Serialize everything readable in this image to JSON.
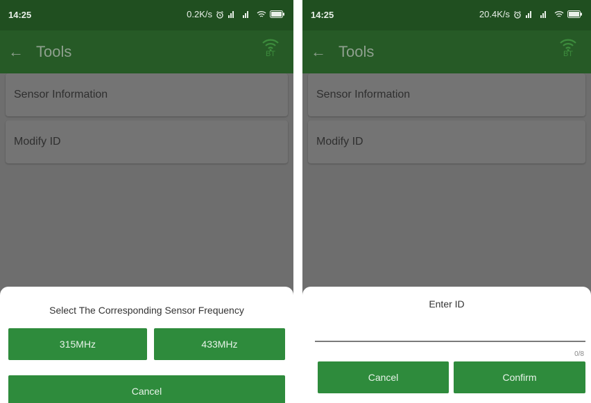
{
  "left": {
    "status": {
      "time": "14:25",
      "speed": "0.2K/s"
    },
    "appbar": {
      "back": "←",
      "title": "Tools",
      "bt_label": "BT"
    },
    "list": [
      {
        "label": "Sensor Information"
      },
      {
        "label": "Modify ID"
      }
    ],
    "dialog": {
      "title": "Select The Corresponding Sensor Frequency",
      "option1": "315MHz",
      "option2": "433MHz",
      "cancel": "Cancel"
    }
  },
  "right": {
    "status": {
      "time": "14:25",
      "speed": "20.4K/s"
    },
    "appbar": {
      "back": "←",
      "title": "Tools",
      "bt_label": "BT"
    },
    "list": [
      {
        "label": "Sensor Information"
      },
      {
        "label": "Modify ID"
      }
    ],
    "dialog": {
      "title": "Enter ID",
      "input_value": "",
      "counter": "0/8",
      "cancel": "Cancel",
      "confirm": "Confirm"
    }
  },
  "colors": {
    "status_bar": "#204f20",
    "app_bar": "#265a26",
    "button": "#2e8b3c",
    "overlay": "#6e6e6e"
  },
  "icons": {
    "back": "arrow-left-icon",
    "bluetooth_wifi": "wifi-icon",
    "alarm": "alarm-icon",
    "signal": "signal-icon",
    "battery": "battery-icon"
  }
}
